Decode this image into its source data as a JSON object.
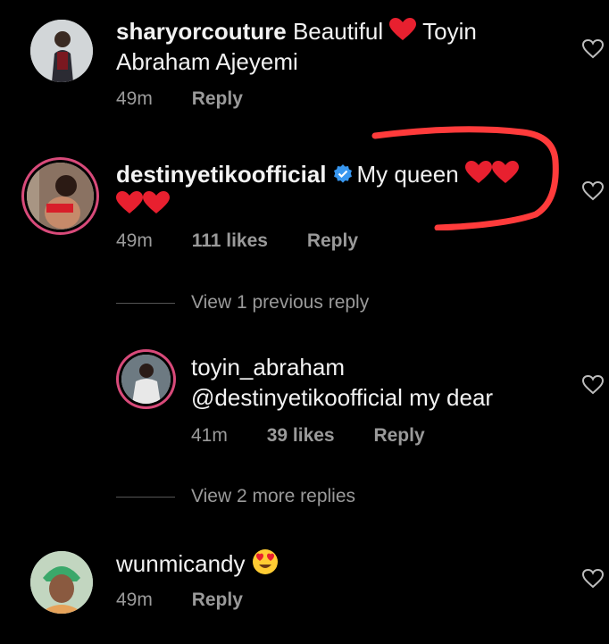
{
  "comments": [
    {
      "username": "sharyorcouture",
      "text_before_heart": "Beautiful",
      "text_after_heart": "Toyin Abraham Ajeyemi",
      "time": "49m",
      "reply": "Reply"
    },
    {
      "username": "destinyetikoofficial",
      "text": "My queen",
      "time": "49m",
      "likes": "111 likes",
      "reply": "Reply",
      "view_previous": "View 1 previous reply"
    },
    {
      "username": "toyin_abraham",
      "mention": "@destinyetikoofficial",
      "text": "my dear",
      "time": "41m",
      "likes": "39 likes",
      "reply": "Reply",
      "view_more": "View 2 more replies"
    },
    {
      "username": "wunmicandy",
      "time": "49m",
      "reply": "Reply"
    }
  ],
  "colors": {
    "heart_emoji": "#e8202f",
    "verified": "#3897f0",
    "annotation": "#ff3b3b",
    "story_ring": "#d84a7a"
  },
  "icons": [
    "heart-outline-icon",
    "verified-badge-icon",
    "heart-emoji-icon",
    "heart-eyes-emoji-icon"
  ]
}
